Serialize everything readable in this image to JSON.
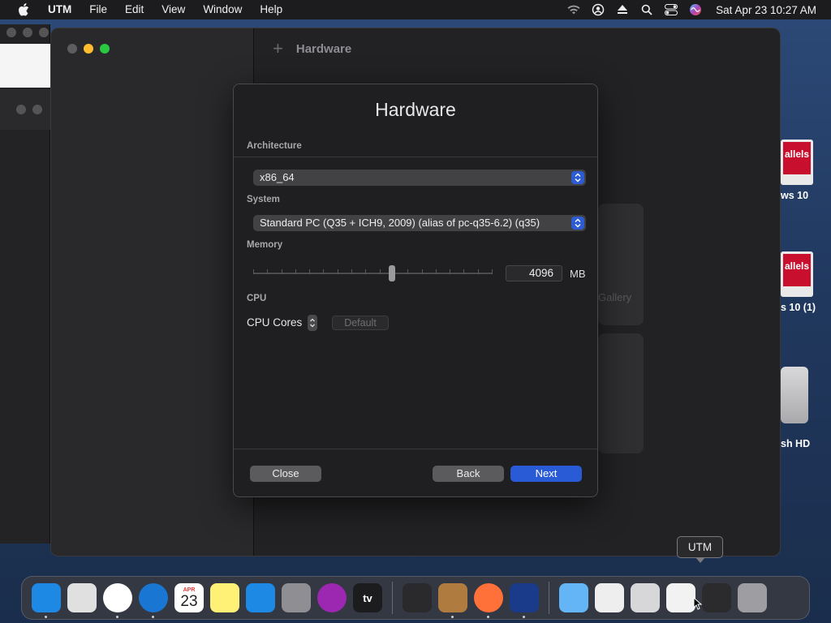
{
  "menubar": {
    "app_name": "UTM",
    "menus": [
      "File",
      "Edit",
      "View",
      "Window",
      "Help"
    ],
    "clock": "Sat Apr 23  10:27 AM"
  },
  "window": {
    "toolbar_title": "Hardware",
    "gallery_label": "Gallery"
  },
  "dialog": {
    "title": "Hardware",
    "architecture": {
      "label": "Architecture",
      "value": "x86_64"
    },
    "system": {
      "label": "System",
      "value": "Standard PC (Q35 + ICH9, 2009) (alias of pc-q35-6.2) (q35)"
    },
    "memory": {
      "label": "Memory",
      "value": "4096",
      "unit": "MB",
      "slider_fraction": 0.58
    },
    "cpu": {
      "section_label": "CPU",
      "cores_label": "CPU Cores",
      "default_label": "Default"
    },
    "buttons": {
      "close": "Close",
      "back": "Back",
      "next": "Next"
    }
  },
  "desktop": {
    "icons": [
      {
        "label": "ws 10",
        "badge": "allels"
      },
      {
        "label": "s 10 (1)",
        "badge": "allels"
      },
      {
        "label": "sh HD"
      }
    ]
  },
  "tooltip": "UTM",
  "dock": {
    "apps": [
      {
        "name": "finder-icon",
        "color": "#1e88e5",
        "running": true
      },
      {
        "name": "launchpad-icon",
        "color": "#e0e0e0",
        "running": false
      },
      {
        "name": "chrome-icon",
        "color": "#ffffff",
        "running": true
      },
      {
        "name": "safari-icon",
        "color": "#1976d2",
        "running": true
      },
      {
        "name": "calendar-icon",
        "color": "#ffffff",
        "running": false
      },
      {
        "name": "notes-icon",
        "color": "#fff176",
        "running": false
      },
      {
        "name": "app-store-icon",
        "color": "#1e88e5",
        "running": false
      },
      {
        "name": "system-preferences-icon",
        "color": "#8e8e93",
        "running": false
      },
      {
        "name": "podcasts-icon",
        "color": "#9c27b0",
        "running": false
      },
      {
        "name": "apple-tv-icon",
        "color": "#1c1c1e",
        "running": false
      },
      {
        "name": "audio-editor-icon",
        "color": "#2a2a2c",
        "running": false
      },
      {
        "name": "archive-utility-icon",
        "color": "#b07b3e",
        "running": true
      },
      {
        "name": "firefox-icon",
        "color": "#ff7139",
        "running": true
      },
      {
        "name": "utm-icon",
        "color": "#1a3a8a",
        "running": true
      },
      {
        "name": "applications-folder-icon",
        "color": "#64b5f6",
        "running": false
      },
      {
        "name": "document-icon",
        "color": "#eeeeee",
        "running": false
      },
      {
        "name": "minimized-window-1-icon",
        "color": "#d7d7da",
        "running": false
      },
      {
        "name": "minimized-window-2-icon",
        "color": "#f2f2f2",
        "running": false
      },
      {
        "name": "minimized-window-3-icon",
        "color": "#2b2b2d",
        "running": false
      },
      {
        "name": "trash-icon",
        "color": "#9e9ea2",
        "running": false
      }
    ],
    "calendar_month": "APR",
    "calendar_day": "23",
    "tv_label": "tv"
  }
}
